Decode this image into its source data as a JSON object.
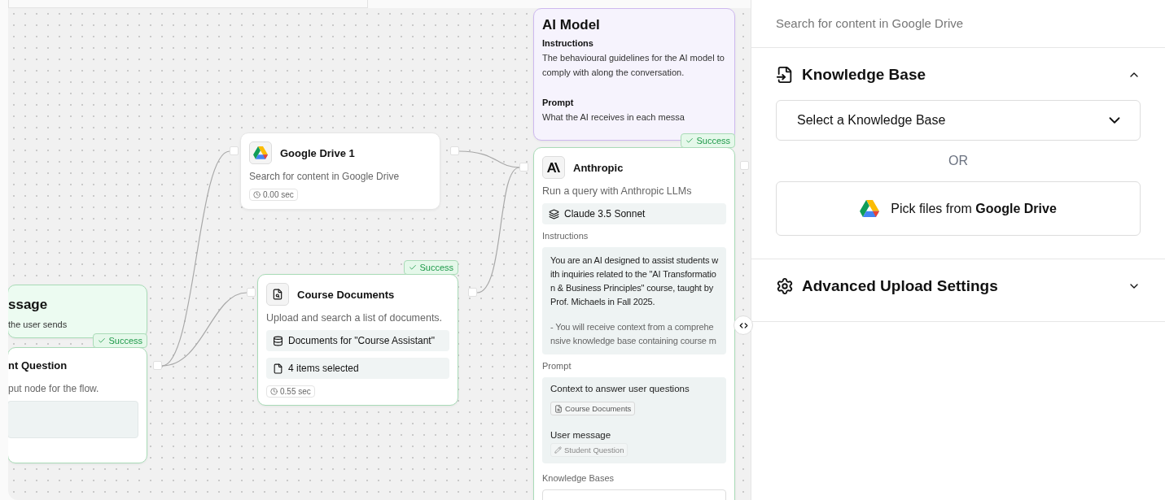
{
  "canvas": {
    "nodes": [
      {
        "kind": "message",
        "title": "ssage",
        "description": "the user sends"
      },
      {
        "kind": "input",
        "title": "nt Question",
        "description": "put node for the flow.",
        "badge": "Success"
      },
      {
        "kind": "google_drive",
        "title": "Google Drive 1",
        "description": "Search for content in Google Drive",
        "time": "0.00 sec"
      },
      {
        "kind": "documents",
        "title": "Course Documents",
        "description": "Upload and search a list of documents.",
        "rows": [
          "Documents for \"Course Assistant\"",
          "4 items selected"
        ],
        "time": "0.55 sec",
        "badge": "Success"
      },
      {
        "kind": "ai_model",
        "title": "AI Model",
        "sections": [
          {
            "label": "Instructions",
            "text": "The behavioural guidelines for the AI model to comply with along the conversation."
          },
          {
            "label": "Prompt",
            "text": "What the AI receives in each messa"
          }
        ]
      },
      {
        "kind": "anthropic",
        "title": "Anthropic",
        "description": "Run a query with Anthropic LLMs",
        "model": "Claude 3.5 Sonnet",
        "instructions_label": "Instructions",
        "instructions": [
          "You are an AI designed to assist students with inquiries related to the \"AI Transformation & Business Principles\" course, taught by Prof. Michaels in Fall 2025.",
          "- You will receive context from a comprehensive knowledge base containing course m"
        ],
        "prompt_label": "Prompt",
        "prompt": [
          {
            "kind": "text",
            "text": "Context to answer user questions"
          },
          {
            "kind": "chip",
            "text": "Course Documents"
          },
          {
            "kind": "text",
            "text": "User message"
          },
          {
            "kind": "faded_chip",
            "text": "Student Question"
          }
        ],
        "knowledge_label": "Knowledge Bases",
        "badge": "Success"
      }
    ]
  },
  "panel": {
    "description": "Search for content in Google Drive",
    "sections": [
      {
        "title": "Knowledge Base",
        "expanded": true,
        "select_placeholder": "Select a Knowledge Base",
        "divider": "OR",
        "pick_button": "Pick files from **Google Drive**"
      },
      {
        "title": "Advanced Upload Settings",
        "expanded": false
      }
    ]
  }
}
